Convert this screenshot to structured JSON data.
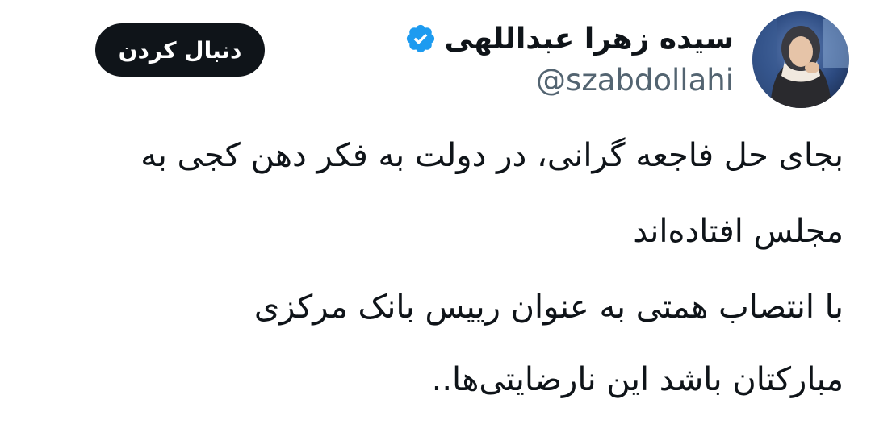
{
  "tweet": {
    "author": {
      "display_name": "سیده زهرا عبداللهی",
      "handle": "@szabdollahi",
      "verified": true,
      "avatar_icon": "profile-photo"
    },
    "follow_button_label": "دنبال کردن",
    "text_lines": [
      "بجای حل فاجعه گرانی، در دولت به فکر دهن کجی به",
      "مجلس افتاده‌اند",
      "با انتصاب همتی به عنوان رییس بانک مرکزی",
      "مبارکتان باشد این نارضایتی‌ها.."
    ]
  },
  "colors": {
    "text_primary": "#0f1419",
    "text_secondary": "#536471",
    "verified_blue": "#1d9bf0",
    "follow_button_bg": "#0f1419",
    "follow_button_text": "#ffffff"
  }
}
